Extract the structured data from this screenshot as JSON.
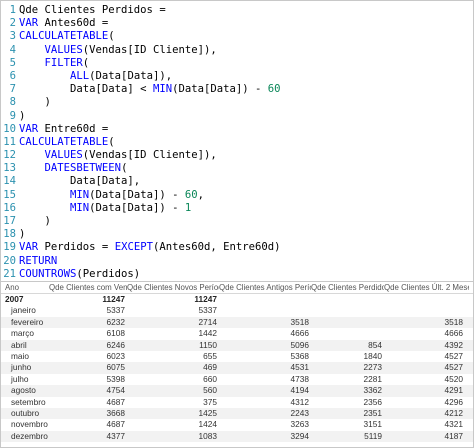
{
  "editor": {
    "lines": [
      {
        "n": "1",
        "tokens": [
          {
            "t": "Qde Clientes Perdidos =",
            "k": "var"
          }
        ]
      },
      {
        "n": "2",
        "tokens": [
          {
            "t": "VAR ",
            "k": "kw"
          },
          {
            "t": "Antes60d",
            "k": "var"
          },
          {
            "t": " =",
            "k": "op"
          }
        ]
      },
      {
        "n": "3",
        "tokens": [
          {
            "t": "CALCULATETABLE",
            "k": "fn"
          },
          {
            "t": "(",
            "k": "op"
          }
        ]
      },
      {
        "n": "4",
        "tokens": [
          {
            "t": "    VALUES",
            "k": "fn"
          },
          {
            "t": "(Vendas[ID Cliente]),",
            "k": "op"
          }
        ]
      },
      {
        "n": "5",
        "tokens": [
          {
            "t": "    FILTER",
            "k": "fn"
          },
          {
            "t": "(",
            "k": "op"
          }
        ]
      },
      {
        "n": "6",
        "tokens": [
          {
            "t": "        ALL",
            "k": "fn"
          },
          {
            "t": "(Data[Data]),",
            "k": "op"
          }
        ]
      },
      {
        "n": "7",
        "tokens": [
          {
            "t": "        Data[Data] < ",
            "k": "op"
          },
          {
            "t": "MIN",
            "k": "fn"
          },
          {
            "t": "(Data[Data]) - ",
            "k": "op"
          },
          {
            "t": "60",
            "k": "num"
          }
        ]
      },
      {
        "n": "8",
        "tokens": [
          {
            "t": "    )",
            "k": "op"
          }
        ]
      },
      {
        "n": "9",
        "tokens": [
          {
            "t": ")",
            "k": "op"
          }
        ]
      },
      {
        "n": "10",
        "tokens": [
          {
            "t": "VAR ",
            "k": "kw"
          },
          {
            "t": "Entre60d",
            "k": "var"
          },
          {
            "t": " =",
            "k": "op"
          }
        ]
      },
      {
        "n": "11",
        "tokens": [
          {
            "t": "CALCULATETABLE",
            "k": "fn"
          },
          {
            "t": "(",
            "k": "op"
          }
        ]
      },
      {
        "n": "12",
        "tokens": [
          {
            "t": "    VALUES",
            "k": "fn"
          },
          {
            "t": "(Vendas[ID Cliente]),",
            "k": "op"
          }
        ]
      },
      {
        "n": "13",
        "tokens": [
          {
            "t": "    DATESBETWEEN",
            "k": "fn"
          },
          {
            "t": "(",
            "k": "op"
          }
        ]
      },
      {
        "n": "14",
        "tokens": [
          {
            "t": "        Data[Data],",
            "k": "op"
          }
        ]
      },
      {
        "n": "15",
        "tokens": [
          {
            "t": "        ",
            "k": "op"
          },
          {
            "t": "MIN",
            "k": "fn"
          },
          {
            "t": "(Data[Data]) - ",
            "k": "op"
          },
          {
            "t": "60",
            "k": "num"
          },
          {
            "t": ",",
            "k": "op"
          }
        ]
      },
      {
        "n": "16",
        "tokens": [
          {
            "t": "        ",
            "k": "op"
          },
          {
            "t": "MIN",
            "k": "fn"
          },
          {
            "t": "(Data[Data]) - ",
            "k": "op"
          },
          {
            "t": "1",
            "k": "num"
          }
        ]
      },
      {
        "n": "17",
        "tokens": [
          {
            "t": "    )",
            "k": "op"
          }
        ]
      },
      {
        "n": "18",
        "tokens": [
          {
            "t": ")",
            "k": "op"
          }
        ]
      },
      {
        "n": "19",
        "tokens": [
          {
            "t": "VAR ",
            "k": "kw"
          },
          {
            "t": "Perdidos",
            "k": "var"
          },
          {
            "t": " = ",
            "k": "op"
          },
          {
            "t": "EXCEPT",
            "k": "fn"
          },
          {
            "t": "(Antes60d, Entre60d)",
            "k": "op"
          }
        ]
      },
      {
        "n": "20",
        "tokens": [
          {
            "t": "RETURN",
            "k": "kw"
          }
        ]
      },
      {
        "n": "21",
        "tokens": [
          {
            "t": "COUNTROWS",
            "k": "fn"
          },
          {
            "t": "(Perdidos)",
            "k": "op"
          }
        ]
      }
    ]
  },
  "table": {
    "headers": [
      "Ano",
      "Qde Clientes com Venda",
      "Qde Clientes Novos Período",
      "Qde Clientes Antigos Período",
      "Qde Clientes Perdidos",
      "Qde Clientes Últ. 2 Meses"
    ],
    "rows": [
      {
        "year": true,
        "cells": [
          "2007",
          "11247",
          "11247",
          "",
          "",
          ""
        ]
      },
      {
        "year": false,
        "cells": [
          "janeiro",
          "5337",
          "5337",
          "",
          "",
          ""
        ]
      },
      {
        "year": false,
        "cells": [
          "fevereiro",
          "6232",
          "2714",
          "3518",
          "",
          "3518"
        ]
      },
      {
        "year": false,
        "cells": [
          "março",
          "6108",
          "1442",
          "4666",
          "",
          "4666"
        ]
      },
      {
        "year": false,
        "cells": [
          "abril",
          "6246",
          "1150",
          "5096",
          "854",
          "4392"
        ]
      },
      {
        "year": false,
        "cells": [
          "maio",
          "6023",
          "655",
          "5368",
          "1840",
          "4527"
        ]
      },
      {
        "year": false,
        "cells": [
          "junho",
          "6075",
          "469",
          "4531",
          "2273",
          "4527"
        ]
      },
      {
        "year": false,
        "cells": [
          "julho",
          "5398",
          "660",
          "4738",
          "2281",
          "4520"
        ]
      },
      {
        "year": false,
        "cells": [
          "agosto",
          "4754",
          "560",
          "4194",
          "3362",
          "4291"
        ]
      },
      {
        "year": false,
        "cells": [
          "setembro",
          "4687",
          "375",
          "4312",
          "2356",
          "4296"
        ]
      },
      {
        "year": false,
        "cells": [
          "outubro",
          "3668",
          "1425",
          "2243",
          "2351",
          "4212"
        ]
      },
      {
        "year": false,
        "cells": [
          "novembro",
          "4687",
          "1424",
          "3263",
          "3151",
          "4321"
        ]
      },
      {
        "year": false,
        "cells": [
          "dezembro",
          "4377",
          "1083",
          "3294",
          "5119",
          "4187"
        ]
      }
    ]
  }
}
